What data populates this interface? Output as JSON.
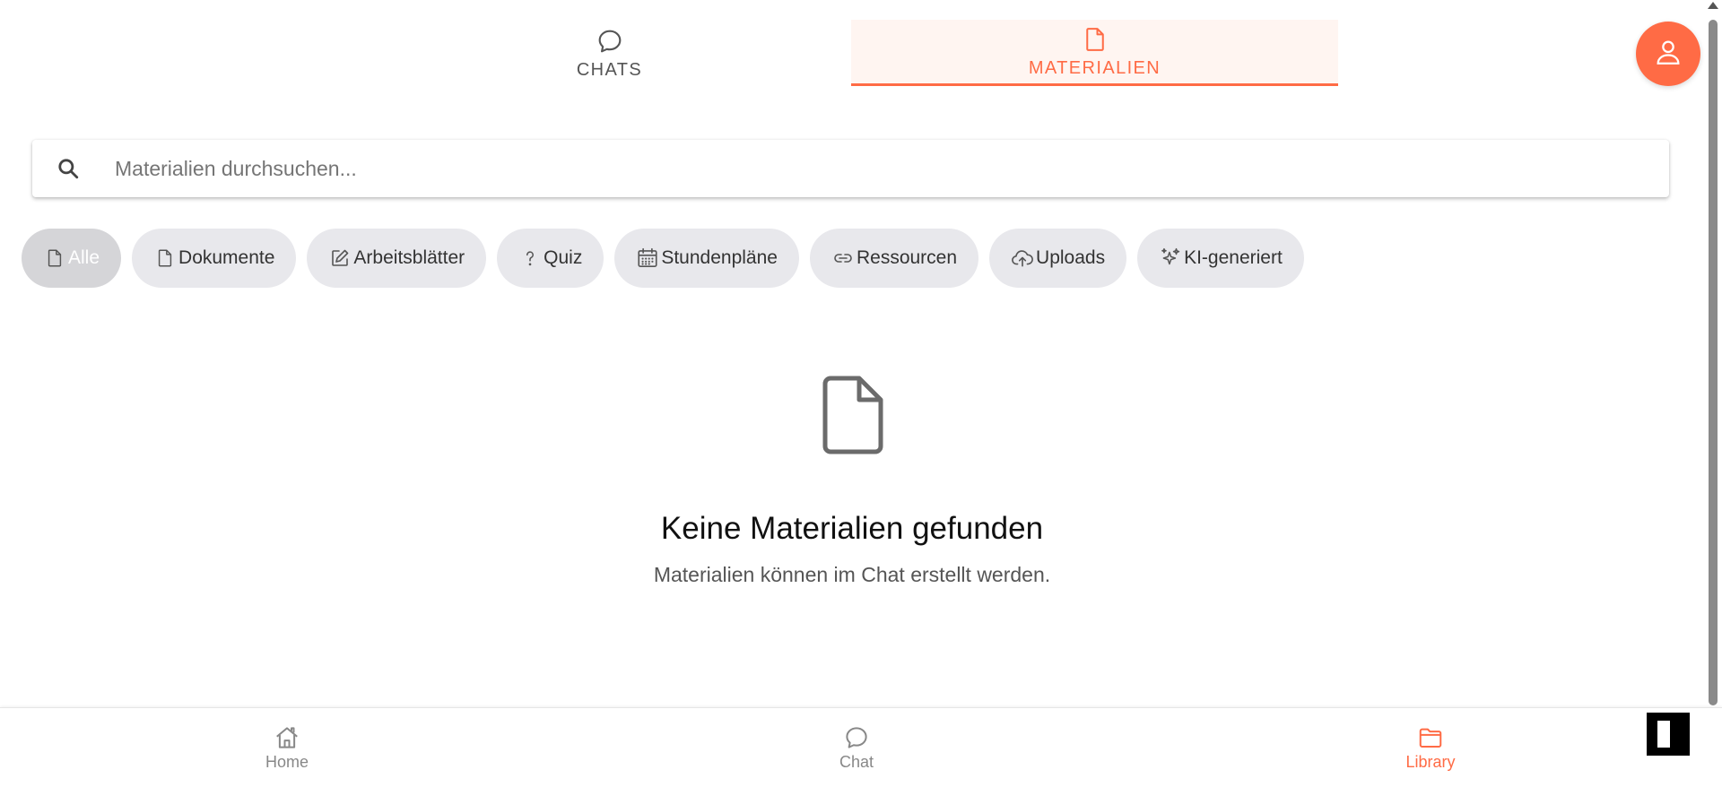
{
  "tabs": [
    {
      "label": "CHATS",
      "icon": "chat-bubble-icon",
      "active": false
    },
    {
      "label": "MATERIALIEN",
      "icon": "document-icon",
      "active": true
    }
  ],
  "search": {
    "placeholder": "Materialien durchsuchen...",
    "value": ""
  },
  "filters": [
    {
      "label": "Alle",
      "icon": "document-icon",
      "active": true
    },
    {
      "label": "Dokumente",
      "icon": "document-icon",
      "active": false
    },
    {
      "label": "Arbeitsblätter",
      "icon": "edit-icon",
      "active": false
    },
    {
      "label": "Quiz",
      "icon": "question-icon",
      "active": false
    },
    {
      "label": "Stundenpläne",
      "icon": "calendar-icon",
      "active": false
    },
    {
      "label": "Ressourcen",
      "icon": "link-icon",
      "active": false
    },
    {
      "label": "Uploads",
      "icon": "cloud-upload-icon",
      "active": false
    },
    {
      "label": "KI-generiert",
      "icon": "sparkles-icon",
      "active": false
    }
  ],
  "empty_state": {
    "title": "Keine Materialien gefunden",
    "subtitle": "Materialien können im Chat erstellt werden."
  },
  "bottom_nav": [
    {
      "label": "Home",
      "icon": "home-icon",
      "active": false
    },
    {
      "label": "Chat",
      "icon": "chat-bubble-icon",
      "active": false
    },
    {
      "label": "Library",
      "icon": "folder-icon",
      "active": true
    }
  ],
  "colors": {
    "accent": "#ff6b45",
    "chip_bg": "#e8e8ec",
    "active_tab_bg": "#fff5f1"
  }
}
